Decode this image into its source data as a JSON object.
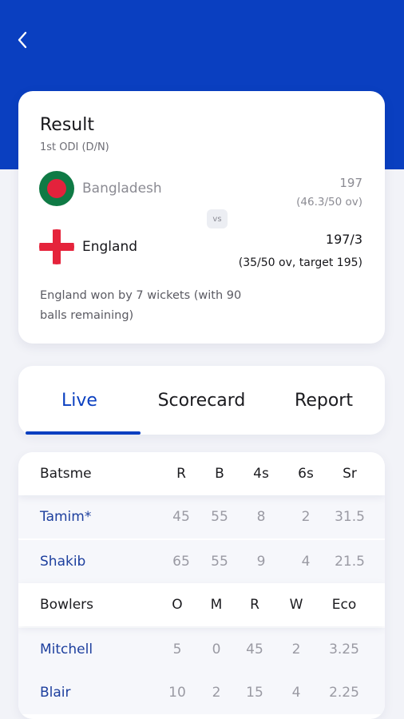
{
  "colors": {
    "primary": "#0a3fc0",
    "background": "#f2f3f8"
  },
  "header": {
    "back_icon": "chevron-left-icon"
  },
  "match": {
    "title": "Result",
    "subtitle": "1st ODI (D/N)",
    "vs": "vs",
    "team1": {
      "name": "Bangladesh",
      "score": "197",
      "overs": "(46.3/50 ov)"
    },
    "team2": {
      "name": "England",
      "score": "197/3",
      "overs": "(35/50 ov, target 195)"
    },
    "result": "England won by 7 wickets (with 90 balls remaining)"
  },
  "tabs": [
    {
      "label": "Live",
      "active": true
    },
    {
      "label": "Scorecard",
      "active": false
    },
    {
      "label": "Report",
      "active": false
    }
  ],
  "batting": {
    "headers": [
      "Batsme",
      "R",
      "B",
      "4s",
      "6s",
      "Sr"
    ],
    "rows": [
      [
        "Tamim*",
        "45",
        "55",
        "8",
        "2",
        "31.5"
      ],
      [
        "Shakib",
        "65",
        "55",
        "9",
        "4",
        "21.5"
      ]
    ]
  },
  "bowling": {
    "headers": [
      "Bowlers",
      "O",
      "M",
      "R",
      "W",
      "Eco"
    ],
    "rows": [
      [
        "Mitchell",
        "5",
        "0",
        "45",
        "2",
        "3.25"
      ],
      [
        "Blair",
        "10",
        "2",
        "15",
        "4",
        "2.25"
      ]
    ]
  }
}
